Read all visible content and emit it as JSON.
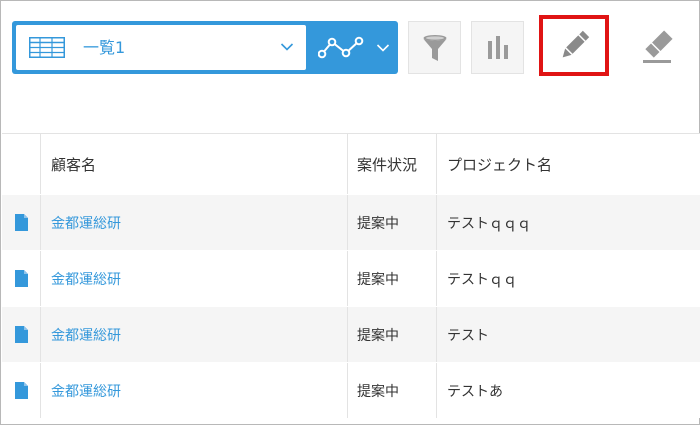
{
  "toolbar": {
    "view_selector": {
      "label": "一覧1",
      "icon": "table-icon"
    },
    "graph_button": {
      "icon": "line-graph-icon"
    },
    "filter_button": {
      "icon": "filter-icon"
    },
    "chart_button": {
      "icon": "bar-chart-icon"
    },
    "edit_button": {
      "icon": "pencil-icon",
      "highlight_color": "#e01414"
    },
    "erase_button": {
      "icon": "eraser-icon"
    }
  },
  "table": {
    "columns": [
      "",
      "顧客名",
      "案件状況",
      "プロジェクト名"
    ],
    "rows": [
      {
        "customer": "金都運総研",
        "status": "提案中",
        "project": "テストｑｑｑ"
      },
      {
        "customer": "金都運総研",
        "status": "提案中",
        "project": "テストｑｑ"
      },
      {
        "customer": "金都運総研",
        "status": "提案中",
        "project": "テスト"
      },
      {
        "customer": "金都運総研",
        "status": "提案中",
        "project": "テストあ"
      }
    ]
  },
  "colors": {
    "accent": "#3498db",
    "row_alt": "#f5f5f5",
    "border": "#e3e3e3",
    "icon_gray": "#9a9a9a"
  }
}
